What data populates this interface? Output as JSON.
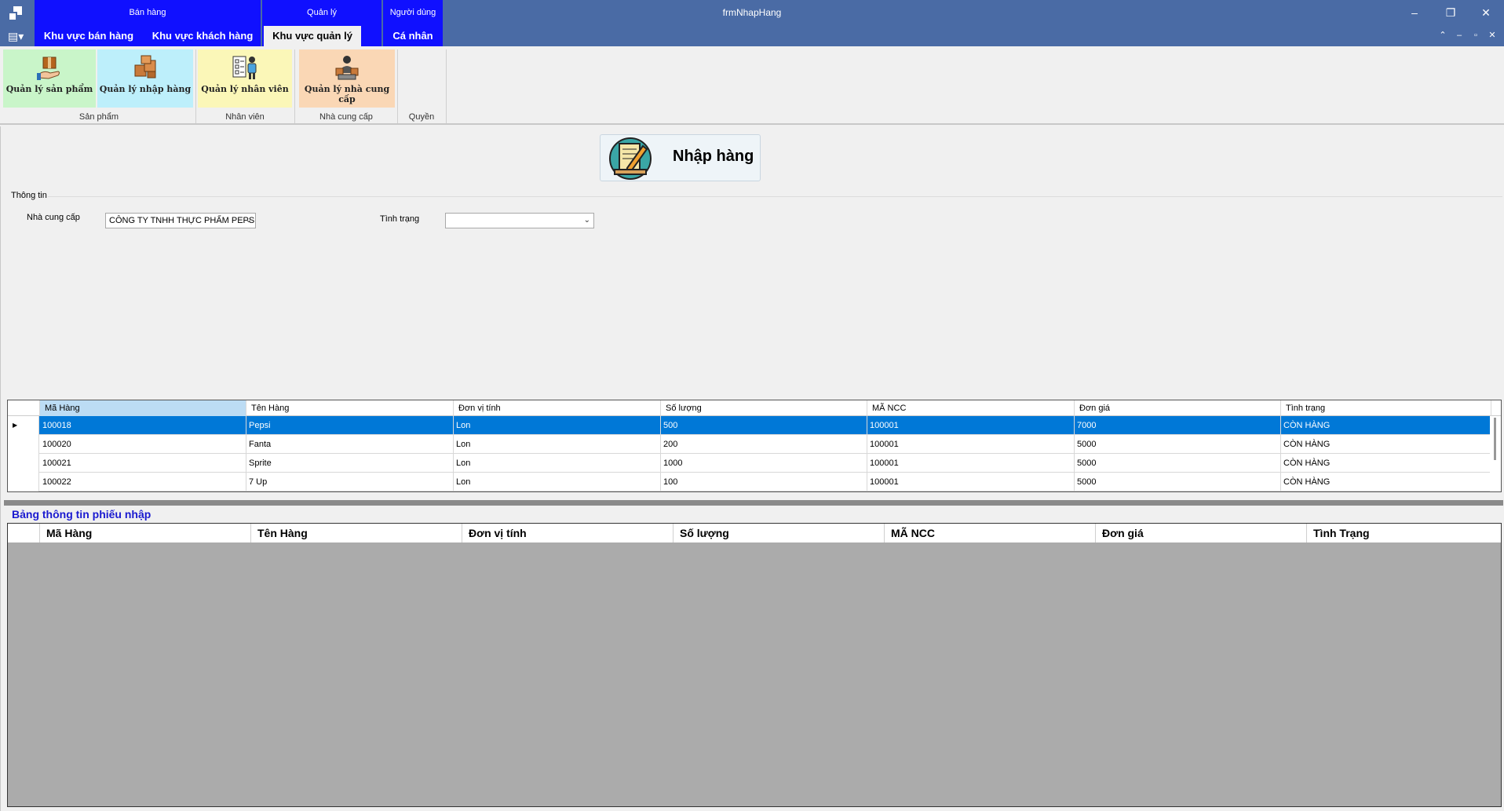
{
  "window": {
    "title": "frmNhapHang",
    "context_categories": [
      "Bán hàng",
      "Quản lý",
      "Người dùng"
    ],
    "tabs": [
      "Khu vực bán hàng",
      "Khu vực khách hàng",
      "Khu vực quản lý",
      "Cá nhân"
    ],
    "active_tab": "Khu vực quản lý",
    "controls": {
      "minimize": "–",
      "restore": "❐",
      "close": "✕"
    },
    "mdi_controls": {
      "up": "⌃",
      "min": "–",
      "restore": "▫",
      "close": "✕"
    }
  },
  "ribbon": {
    "buttons": [
      {
        "label": "Quản lý sản phẩm",
        "icon": "product-box-icon",
        "color": "#c9f5c9"
      },
      {
        "label": "Quản lý nhập hàng",
        "icon": "import-boxes-icon",
        "color": "#bdeffb"
      },
      {
        "label": "Quản lý nhân viên",
        "icon": "employee-checklist-icon",
        "color": "#fbf7b8"
      },
      {
        "label": "Quản lý nhà cung cấp",
        "icon": "supplier-icon",
        "color": "#fad7b5"
      }
    ],
    "groups": [
      "Sản phẩm",
      "Nhân viên",
      "Nhà cung cấp",
      "Quyền"
    ]
  },
  "header": {
    "title": "Nhập hàng",
    "icon": "notepad-pencil-icon"
  },
  "form": {
    "section_label": "Thông tin",
    "supplier_label": "Nhà cung cấp",
    "supplier_value": "CÔNG TY TNHH THỰC PHẨM PEPSI",
    "status_label": "Tình trạng",
    "status_value": ""
  },
  "products_table": {
    "columns": [
      "Mã Hàng",
      "Tên Hàng",
      "Đơn vị tính",
      "Số lượng",
      "MÃ NCC",
      "Đơn giá",
      "Tình trạng"
    ],
    "rows": [
      [
        "100018",
        "Pepsi",
        "Lon",
        "500",
        "100001",
        "7000",
        "CÒN HÀNG"
      ],
      [
        "100020",
        "Fanta",
        "Lon",
        "200",
        "100001",
        "5000",
        "CÒN HÀNG"
      ],
      [
        "100021",
        "Sprite",
        "Lon",
        "1000",
        "100001",
        "5000",
        "CÒN HÀNG"
      ],
      [
        "100022",
        "7 Up",
        "Lon",
        "100",
        "100001",
        "5000",
        "CÒN HÀNG"
      ]
    ],
    "selected_row": 0
  },
  "receipt_table": {
    "title": "Bảng thông tin phiếu nhập",
    "columns": [
      "Mã Hàng",
      "Tên Hàng",
      "Đơn vị tính",
      "Số lượng",
      "MÃ NCC",
      "Đơn giá",
      "Tình Trạng"
    ]
  },
  "colors": {
    "titlebar": "#4a6ba5",
    "context_category": "#1010ff",
    "selection": "#0078d7",
    "section_title": "#1a1ad0"
  }
}
